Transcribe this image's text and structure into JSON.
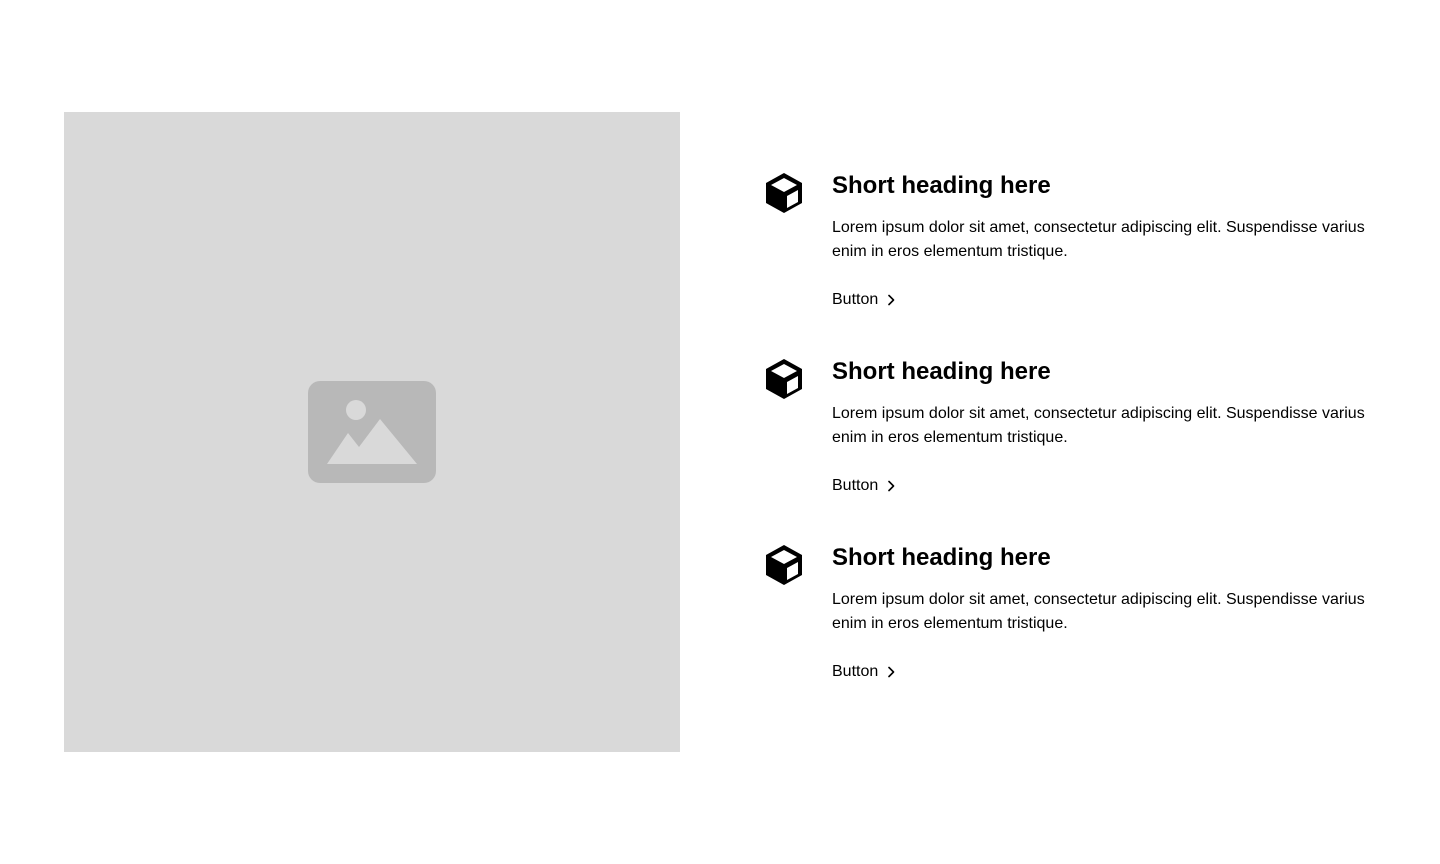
{
  "colors": {
    "placeholder_bg": "#d9d9d9",
    "placeholder_icon": "#b8b8b8",
    "text": "#000000"
  },
  "image": {
    "icon": "image-placeholder-icon"
  },
  "features": [
    {
      "icon": "cube-icon",
      "heading": "Short heading here",
      "body": "Lorem ipsum dolor sit amet, consectetur adipiscing elit. Suspendisse varius enim in eros elementum tristique.",
      "button_label": "Button",
      "button_icon": "chevron-right-icon"
    },
    {
      "icon": "cube-icon",
      "heading": "Short heading here",
      "body": "Lorem ipsum dolor sit amet, consectetur adipiscing elit. Suspendisse varius enim in eros elementum tristique.",
      "button_label": "Button",
      "button_icon": "chevron-right-icon"
    },
    {
      "icon": "cube-icon",
      "heading": "Short heading here",
      "body": "Lorem ipsum dolor sit amet, consectetur adipiscing elit. Suspendisse varius enim in eros elementum tristique.",
      "button_label": "Button",
      "button_icon": "chevron-right-icon"
    }
  ]
}
